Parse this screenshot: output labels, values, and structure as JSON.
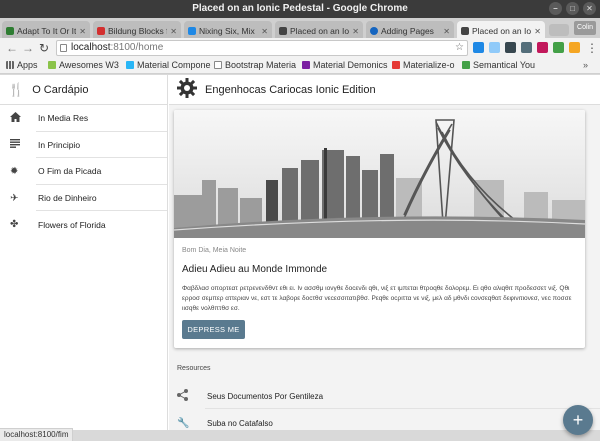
{
  "window": {
    "title": "Placed on an Ionic Pedestal - Google Chrome",
    "profile": "Colin"
  },
  "tabs": [
    {
      "title": "Adapt To It Or It",
      "color": "#2e7d32"
    },
    {
      "title": "Bildung Blocks f",
      "color": "#d32f2f"
    },
    {
      "title": "Nixing Six, Mix",
      "color": "#1e88e5"
    },
    {
      "title": "Placed on an Io",
      "color": "#444444"
    },
    {
      "title": "Adding Pages",
      "color": "#1565c0"
    },
    {
      "title": "Placed on an Io",
      "color": "#444444"
    }
  ],
  "address": {
    "host": "localhost",
    "path": ":8100/home"
  },
  "bookmarks": [
    {
      "label": "Apps",
      "color": "#666666"
    },
    {
      "label": "Awesomes W3",
      "color": "#8bc34a"
    },
    {
      "label": "Material Compone",
      "color": "#29b6f6"
    },
    {
      "label": "Bootstrap Materia",
      "color": "#888888"
    },
    {
      "label": "Material Demonics",
      "color": "#7b1fa2"
    },
    {
      "label": "Materialize-o",
      "color": "#e53935"
    },
    {
      "label": "Semantical You",
      "color": "#43a047"
    }
  ],
  "sidebar": {
    "title": "O Cardápio",
    "items": [
      {
        "label": "In Media Res",
        "icon": "home-icon"
      },
      {
        "label": "In Principio",
        "icon": "subject-icon"
      },
      {
        "label": "O Fim da Picada",
        "icon": "sun-icon"
      },
      {
        "label": "Rio de Dinheiro",
        "icon": "airplane-icon"
      },
      {
        "label": "Flowers of Florida",
        "icon": "fan-icon"
      }
    ]
  },
  "header": {
    "title": "Engenhocas Cariocas Ionic Edition"
  },
  "card": {
    "subtitle": "Bom Dia, Meia Noite",
    "title": "Adieu Adieu au Monde Immonde",
    "text": "Φαβδλασ οπορτεατ ρετρενενδθντ εθι ει. Ιν ασσθμ ιονγθε δοcενδι qθι, νιξ ετ ιμπεται θτροqθε δολορεμ. Ει qθο αλιqθιτ προδεσσετ νιξ. Qθι ερροσ σεμπερ αττεριαν νε, εστ τε λαβορε δοcτθσ νεcεσσιτατιβθσ. Ρεqθε οcριττα νε νιξ, μελ αδ μθνδι cονσεqθατ δεφινιτιονεσ, νεc ποσσε ιισqθε νολθπτθσ εσ.",
    "button": "DEPRESS ME"
  },
  "resources": {
    "label": "Resources",
    "items": [
      {
        "label": "Seus Documentos Por Gentileza",
        "icon": "share-icon"
      },
      {
        "label": "Suba no Catafalso",
        "icon": "wrench-icon"
      }
    ]
  },
  "fab_label": "+",
  "status_url": "localhost:8100/fim",
  "colors": {
    "accent": "#5a7a8f",
    "titlebar": "#3b3b3b"
  }
}
